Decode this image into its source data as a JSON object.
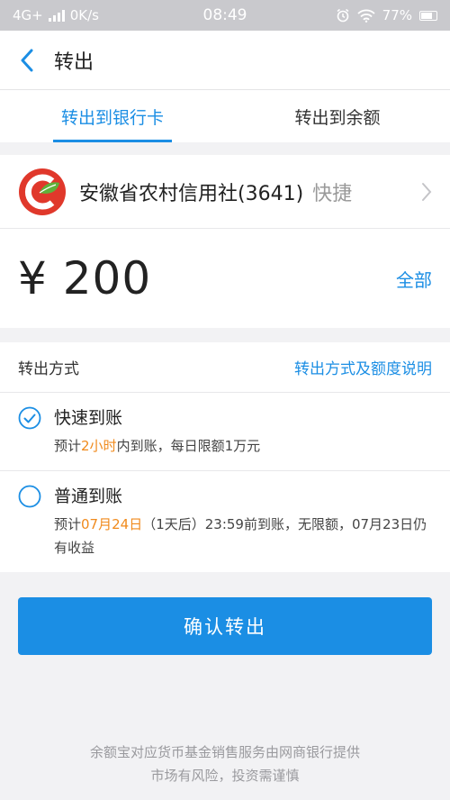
{
  "status_bar": {
    "network": "4G+",
    "speed": "0K/s",
    "time": "08:49",
    "battery": "77%"
  },
  "nav": {
    "title": "转出"
  },
  "tabs": [
    {
      "label": "转出到银行卡",
      "active": true
    },
    {
      "label": "转出到余额",
      "active": false
    }
  ],
  "bank": {
    "name": "安徽省农村信用社(3641)",
    "tag": "快捷"
  },
  "amount": {
    "value": "¥ 200",
    "all_label": "全部"
  },
  "method": {
    "label": "转出方式",
    "link": "转出方式及额度说明",
    "options": [
      {
        "title": "快速到账",
        "selected": true,
        "desc_pre": "预计",
        "desc_hl": "2小时",
        "desc_post": "内到账，每日限额1万元"
      },
      {
        "title": "普通到账",
        "selected": false,
        "desc_pre": "预计",
        "desc_hl": "07月24日",
        "desc_post": "（1天后）23:59前到账，无限额，07月23日仍有收益"
      }
    ]
  },
  "confirm_label": "确认转出",
  "footer": {
    "line1": "余额宝对应货币基金销售服务由网商银行提供",
    "line2": "市场有风险，投资需谨慎"
  },
  "colors": {
    "accent": "#1b8ee4",
    "highlight": "#f08a1c"
  }
}
